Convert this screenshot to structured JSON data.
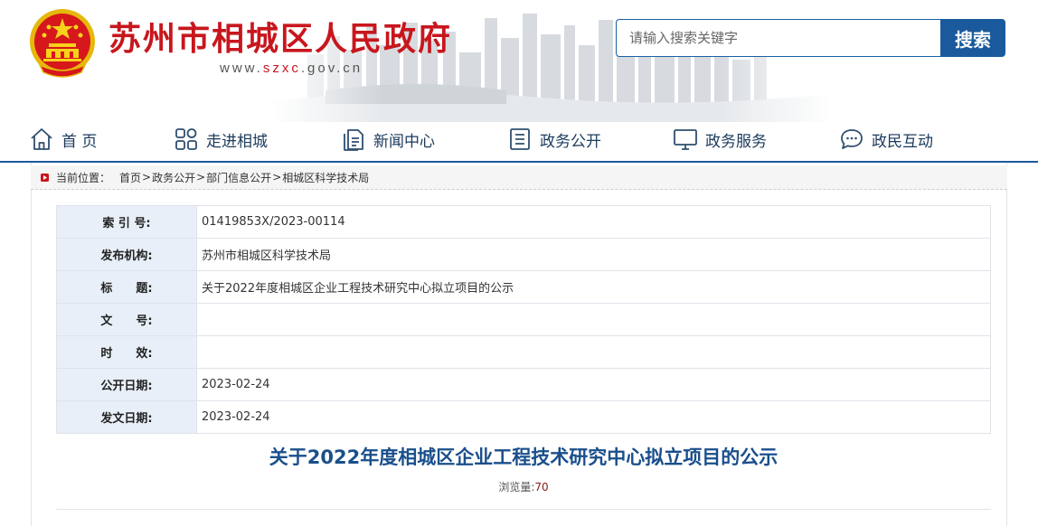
{
  "header": {
    "site_title": "苏州市相城区人民政府",
    "url_prefix": "www.",
    "url_domain": "szxc",
    "url_suffix": ".gov.cn",
    "search": {
      "placeholder": "请输入搜索关键字",
      "button_label": "搜索"
    }
  },
  "nav": {
    "items": [
      {
        "label": "首 页",
        "icon": "home-icon"
      },
      {
        "label": "走进相城",
        "icon": "grid-icon"
      },
      {
        "label": "新闻中心",
        "icon": "document-icon"
      },
      {
        "label": "政务公开",
        "icon": "list-icon"
      },
      {
        "label": "政务服务",
        "icon": "monitor-icon"
      },
      {
        "label": "政民互动",
        "icon": "chat-icon"
      }
    ]
  },
  "breadcrumb": {
    "label": "当前位置：",
    "items": [
      "首页",
      "政务公开",
      "部门信息公开",
      "相城区科学技术局"
    ],
    "separator": ">"
  },
  "info_table": {
    "rows": [
      {
        "key": "索 引 号:",
        "value": "01419853X/2023-00114"
      },
      {
        "key": "发布机构:",
        "value": "苏州市相城区科学技术局"
      },
      {
        "key": "标　　题:",
        "value": "关于2022年度相城区企业工程技术研究中心拟立项目的公示"
      },
      {
        "key": "文　　号:",
        "value": ""
      },
      {
        "key": "时　　效:",
        "value": ""
      },
      {
        "key": "公开日期:",
        "value": "2023-02-24"
      },
      {
        "key": "发文日期:",
        "value": "2023-02-24"
      }
    ]
  },
  "article": {
    "title": "关于2022年度相城区企业工程技术研究中心拟立项目的公示",
    "views_label": "浏览量:",
    "views_count": "70"
  },
  "colors": {
    "brand_red": "#c8161d",
    "brand_blue": "#1a5a9c",
    "key_cell_bg": "#e8eff8"
  }
}
